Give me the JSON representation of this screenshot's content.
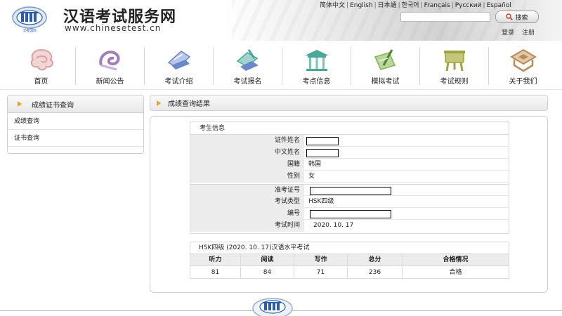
{
  "header": {
    "title": "汉语考试服务网",
    "url": "www.chinesetest.cn",
    "languages": [
      "简体中文",
      "English",
      "日本語",
      "한국어",
      "Français",
      "Русский",
      "Español"
    ],
    "search_button": "搜索",
    "login": "登录",
    "register": "注册",
    "logo_caption": "汉考国际"
  },
  "nav": [
    {
      "label": "首页",
      "icon": "home-icon"
    },
    {
      "label": "新闻公告",
      "icon": "news-icon"
    },
    {
      "label": "考试介绍",
      "icon": "intro-icon"
    },
    {
      "label": "考试报名",
      "icon": "register-icon"
    },
    {
      "label": "考点信息",
      "icon": "center-icon"
    },
    {
      "label": "模拟考试",
      "icon": "mock-icon"
    },
    {
      "label": "考试规则",
      "icon": "rules-icon"
    },
    {
      "label": "关于我们",
      "icon": "about-icon"
    }
  ],
  "sidebar": {
    "title": "成绩证书查询",
    "items": [
      "成绩查询",
      "证书查询"
    ]
  },
  "result": {
    "title": "成绩查询结果",
    "info_title": "考生信息",
    "rows": [
      {
        "label": "证件姓名",
        "value": ""
      },
      {
        "label": "中文姓名",
        "value": ""
      },
      {
        "label": "国籍",
        "value": "韩国"
      },
      {
        "label": "性别",
        "value": "女"
      },
      {
        "label": "准考证号",
        "value": ""
      },
      {
        "label": "考试类型",
        "value": "HSK四级"
      },
      {
        "label": "编号",
        "value": ""
      },
      {
        "label": "考试时间",
        "value": "2020. 10. 17"
      }
    ],
    "score_title": "HSK四级 (2020. 10. 17)汉语水平考试",
    "score_headers": [
      "听力",
      "阅读",
      "写作",
      "总分",
      "合格情况"
    ],
    "score_values": [
      "81",
      "84",
      "71",
      "236",
      "合格"
    ]
  },
  "colors": {
    "accent": "#e7a11a",
    "nav_icon_pink": "#d9a0a0",
    "nav_icon_purple": "#a27db8",
    "nav_icon_blue": "#6a87c9",
    "nav_icon_teal": "#4aa79a",
    "nav_icon_green": "#7fb25c",
    "nav_icon_olive": "#9da43f",
    "nav_icon_brown": "#b98a5a",
    "logo_blue": "#2b5ea6"
  }
}
